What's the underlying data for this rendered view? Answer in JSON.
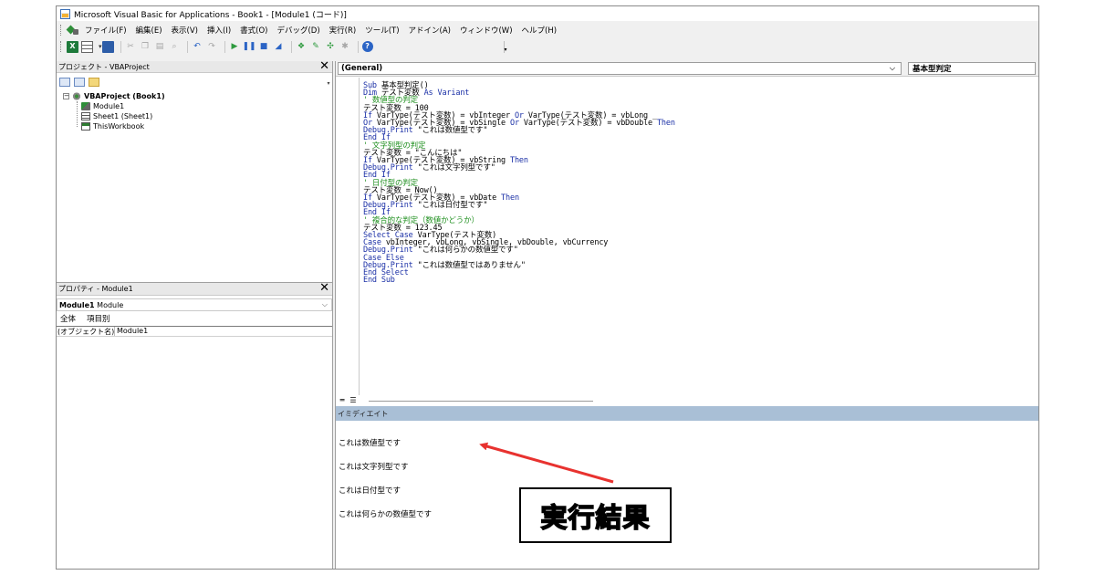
{
  "window": {
    "title": "Microsoft Visual Basic for Applications - Book1 - [Module1 (コード)]"
  },
  "menu": [
    "ファイル(F)",
    "編集(E)",
    "表示(V)",
    "挿入(I)",
    "書式(O)",
    "デバッグ(D)",
    "実行(R)",
    "ツール(T)",
    "アドイン(A)",
    "ウィンドウ(W)",
    "ヘルプ(H)"
  ],
  "project": {
    "title": "プロジェクト - VBAProject",
    "root": "VBAProject (Book1)",
    "items": [
      "Module1",
      "Sheet1 (Sheet1)",
      "ThisWorkbook"
    ]
  },
  "properties": {
    "title": "プロパティ - Module1",
    "object_name": "Module1",
    "object_type": "Module",
    "tabs": [
      "全体",
      "項目別"
    ],
    "rows": [
      {
        "key": "(オブジェクト名)",
        "value": "Module1"
      }
    ]
  },
  "code": {
    "object_combo": "(General)",
    "proc_combo": "基本型判定",
    "lines": [
      [
        {
          "t": "Sub ",
          "c": "kw"
        },
        {
          "t": "基本型判定()",
          "c": ""
        }
      ],
      [
        {
          "t": "Dim ",
          "c": "kw"
        },
        {
          "t": "テスト変数 ",
          "c": ""
        },
        {
          "t": "As Variant",
          "c": "kw"
        }
      ],
      [
        {
          "t": "' 数値型の判定",
          "c": "cm"
        }
      ],
      [
        {
          "t": "テスト変数 = 100",
          "c": ""
        }
      ],
      [
        {
          "t": "If ",
          "c": "kw"
        },
        {
          "t": "VarType(テスト変数) = vbInteger ",
          "c": ""
        },
        {
          "t": "Or ",
          "c": "kw"
        },
        {
          "t": "VarType(テスト変数) = vbLong _",
          "c": ""
        }
      ],
      [
        {
          "t": "Or ",
          "c": "kw"
        },
        {
          "t": "VarType(テスト変数) = vbSingle ",
          "c": ""
        },
        {
          "t": "Or ",
          "c": "kw"
        },
        {
          "t": "VarType(テスト変数) = vbDouble ",
          "c": ""
        },
        {
          "t": "Then",
          "c": "kw"
        }
      ],
      [
        {
          "t": "Debug.Print ",
          "c": "kw"
        },
        {
          "t": "\"これは数値型です\"",
          "c": ""
        }
      ],
      [
        {
          "t": "End If",
          "c": "kw"
        }
      ],
      [
        {
          "t": "' 文字列型の判定",
          "c": "cm"
        }
      ],
      [
        {
          "t": "テスト変数 = \"こんにちは\"",
          "c": ""
        }
      ],
      [
        {
          "t": "If ",
          "c": "kw"
        },
        {
          "t": "VarType(テスト変数) = vbString ",
          "c": ""
        },
        {
          "t": "Then",
          "c": "kw"
        }
      ],
      [
        {
          "t": "Debug.Print ",
          "c": "kw"
        },
        {
          "t": "\"これは文字列型です\"",
          "c": ""
        }
      ],
      [
        {
          "t": "End If",
          "c": "kw"
        }
      ],
      [
        {
          "t": "' 日付型の判定",
          "c": "cm"
        }
      ],
      [
        {
          "t": "テスト変数 = Now()",
          "c": ""
        }
      ],
      [
        {
          "t": "If ",
          "c": "kw"
        },
        {
          "t": "VarType(テスト変数) = vbDate ",
          "c": ""
        },
        {
          "t": "Then",
          "c": "kw"
        }
      ],
      [
        {
          "t": "Debug.Print ",
          "c": "kw"
        },
        {
          "t": "\"これは日付型です\"",
          "c": ""
        }
      ],
      [
        {
          "t": "End If",
          "c": "kw"
        }
      ],
      [
        {
          "t": "' 複合的な判定（数値かどうか）",
          "c": "cm"
        }
      ],
      [
        {
          "t": "テスト変数 = 123.45",
          "c": ""
        }
      ],
      [
        {
          "t": "Select Case ",
          "c": "kw"
        },
        {
          "t": "VarType(テスト変数)",
          "c": ""
        }
      ],
      [
        {
          "t": "Case ",
          "c": "kw"
        },
        {
          "t": "vbInteger, vbLong, vbSingle, vbDouble, vbCurrency",
          "c": ""
        }
      ],
      [
        {
          "t": "Debug.Print ",
          "c": "kw"
        },
        {
          "t": "\"これは何らかの数値型です\"",
          "c": ""
        }
      ],
      [
        {
          "t": "Case Else",
          "c": "kw"
        }
      ],
      [
        {
          "t": "Debug.Print ",
          "c": "kw"
        },
        {
          "t": "\"これは数値型ではありません\"",
          "c": ""
        }
      ],
      [
        {
          "t": "End Select",
          "c": "kw"
        }
      ],
      [
        {
          "t": "End Sub",
          "c": "kw"
        }
      ]
    ]
  },
  "immediate": {
    "title": "イミディエイト",
    "lines": [
      "これは数値型です",
      "これは文字列型です",
      "これは日付型です",
      "これは何らかの数値型です"
    ]
  },
  "annotation": {
    "label": "実行結果",
    "arrow_color": "#e8322f"
  },
  "colors": {
    "keyword": "#1a2fa6",
    "comment": "#1e8f1e",
    "immediate_title_bg": "#a9bfd6"
  }
}
